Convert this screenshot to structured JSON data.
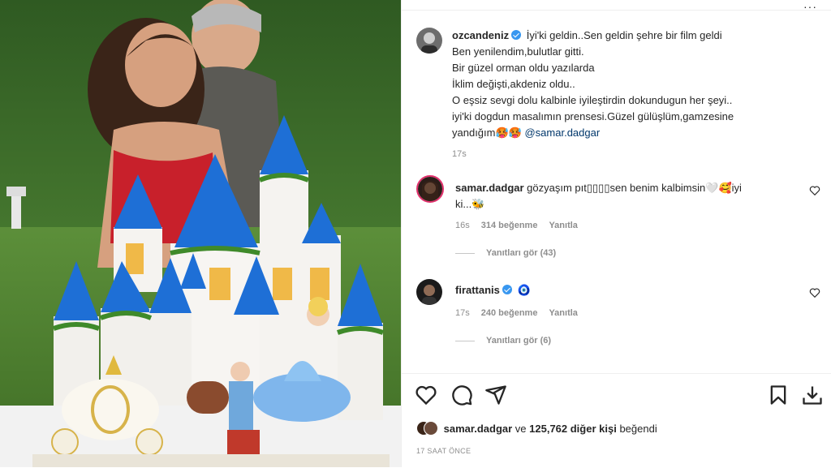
{
  "post": {
    "author": "ozcandeniz",
    "caption_lines": [
      "İyi'ki geldin..Sen geldin şehre bir film geldi",
      "Ben yenilendim,bulutlar gitti.",
      "Bir güzel orman oldu yazılarda",
      "İklim değişti,akdeniz oldu..",
      "O eşsiz sevgi dolu kalbinle iyileştirdin dokundugun her şeyi..",
      "iyi'ki dogdun masalımın prensesi.Güzel gülüşlüm,gamzesine",
      "yandığım🥵🥵"
    ],
    "mention": "@samar.dadgar",
    "time": "17s"
  },
  "comments": [
    {
      "user": "samar.dadgar",
      "text": "gözyaşım pıt����sen benim kalbimsin🤍🥰iyi ki...🐝",
      "text_line1": "gözyaşım pıt▯▯▯▯sen benim kalbimsin🤍🥰iyi",
      "text_line2": "ki...🐝",
      "time": "16s",
      "likes": "314 beğenme",
      "reply": "Yanıtla",
      "view_replies": "Yanıtları gör (43)"
    },
    {
      "user": "firattanis",
      "text": "🧿",
      "time": "17s",
      "likes": "240 beğenme",
      "reply": "Yanıtla",
      "view_replies": "Yanıtları gör (6)"
    }
  ],
  "footer": {
    "liked_by_user": "samar.dadgar",
    "liked_by_mid": " ve ",
    "liked_by_count": "125,762 diğer kişi",
    "liked_by_end": " beğendi",
    "timestamp": "17 SAAT ÖNCE"
  },
  "colors": {
    "verified": "#3897f0",
    "mention": "#00376b",
    "muted": "#8e8e8e"
  },
  "icons": [
    "heart-icon",
    "comment-icon",
    "share-icon",
    "bookmark-icon",
    "download-icon",
    "more-icon"
  ]
}
